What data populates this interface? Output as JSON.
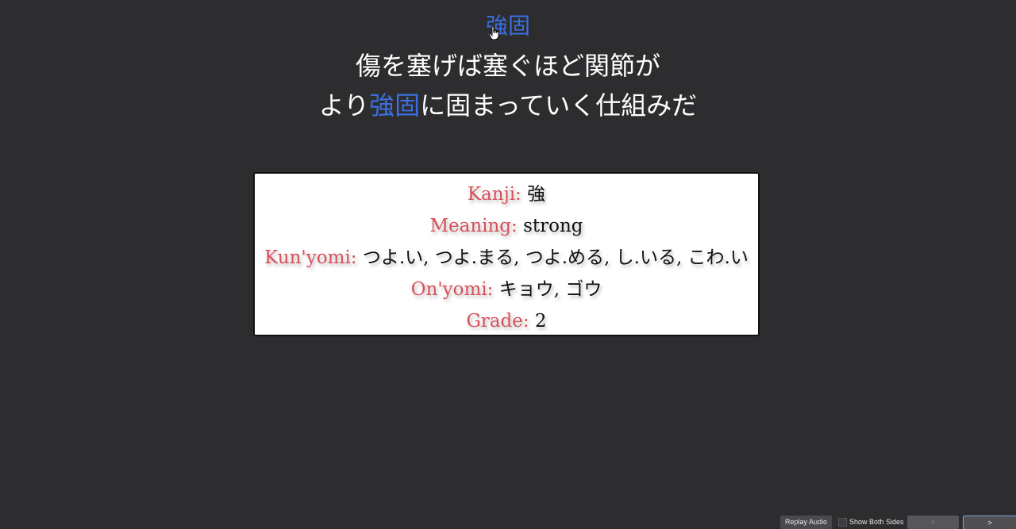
{
  "header": {
    "word": "強固"
  },
  "sentence": {
    "line1": "傷を塞げば塞ぐほど関節が",
    "line2_before": "より",
    "line2_highlight": "強固",
    "line2_after": "に固まっていく仕組みだ"
  },
  "card": {
    "rows": [
      {
        "label": "Kanji:",
        "value": "強"
      },
      {
        "label": "Meaning:",
        "value": "strong"
      },
      {
        "label": "Kun'yomi:",
        "value": "つよ.い, つよ.まる, つよ.める, し.いる, こわ.い"
      },
      {
        "label": "On'yomi:",
        "value": "キョウ, ゴウ"
      },
      {
        "label": "Grade:",
        "value": "2"
      }
    ]
  },
  "controls": {
    "replay_audio": "Replay Audio",
    "show_both_sides": "Show Both Sides",
    "prev": "<",
    "next": ">"
  },
  "colors": {
    "background": "#2d2d30",
    "highlight": "#3a6fe0",
    "label": "#d9505a"
  },
  "icons": {
    "cursor": "hand-pointer-icon"
  }
}
